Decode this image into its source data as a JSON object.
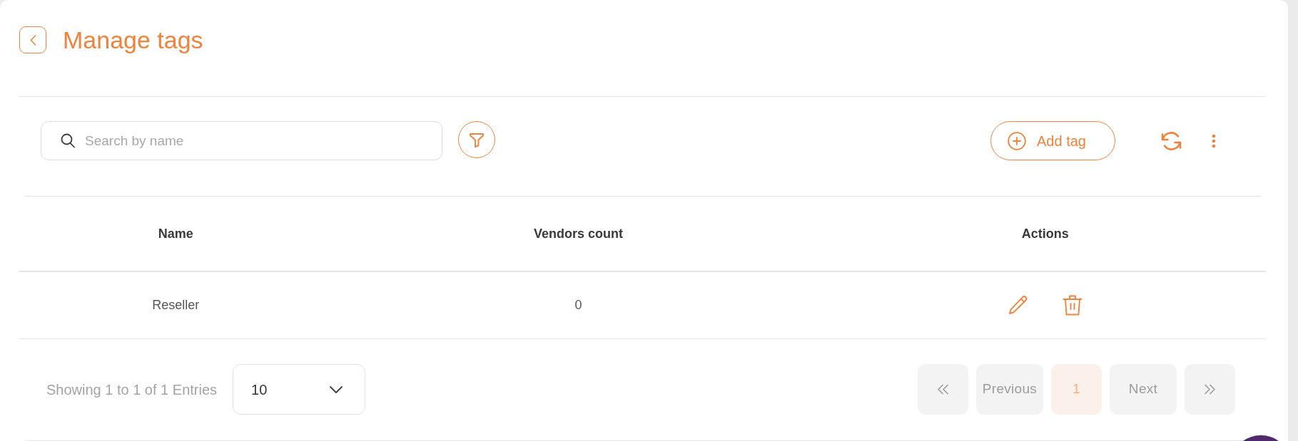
{
  "header": {
    "title": "Manage tags"
  },
  "toolbar": {
    "search": {
      "placeholder": "Search by name"
    },
    "add_button": {
      "label": "Add tag"
    }
  },
  "table": {
    "columns": [
      {
        "label": "Name"
      },
      {
        "label": "Vendors count"
      },
      {
        "label": "Actions"
      }
    ],
    "rows": [
      {
        "cells": [
          "Reseller",
          "0"
        ]
      }
    ]
  },
  "footer": {
    "summary": "Showing 1 to 1 of 1 Entries",
    "page_size": {
      "value": "10"
    },
    "pagination": {
      "first": {
        "disabled": true
      },
      "previous": {
        "label": "Previous",
        "disabled": true
      },
      "pages": [
        {
          "label": "1",
          "selected": true
        }
      ],
      "next": {
        "label": "Next",
        "disabled": true
      },
      "last": {
        "disabled": true
      }
    }
  }
}
